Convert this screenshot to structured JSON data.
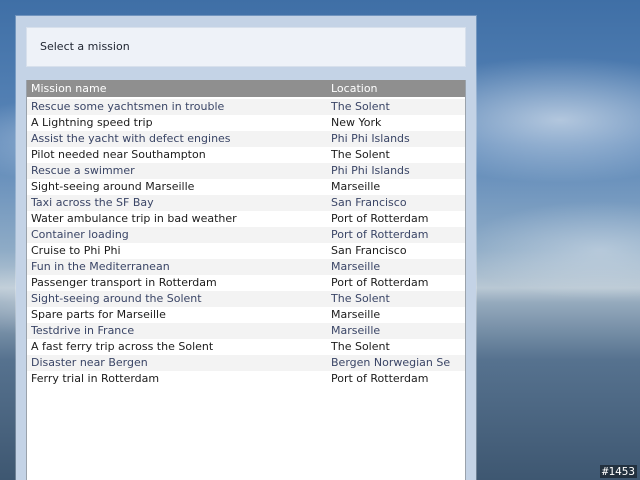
{
  "screen": {
    "title": "Select a mission"
  },
  "mission_list": {
    "columns": {
      "name": "Mission name",
      "location": "Location"
    },
    "rows": [
      {
        "name": "Rescue some yachtsmen in trouble",
        "location": "The Solent"
      },
      {
        "name": "A Lightning speed trip",
        "location": "New York"
      },
      {
        "name": "Assist the yacht with defect engines",
        "location": "Phi Phi Islands"
      },
      {
        "name": "Pilot needed near Southampton",
        "location": "The Solent"
      },
      {
        "name": "Rescue a swimmer",
        "location": "Phi Phi Islands"
      },
      {
        "name": "Sight-seeing around Marseille",
        "location": "Marseille"
      },
      {
        "name": "Taxi across the SF Bay",
        "location": "San Francisco"
      },
      {
        "name": "Water ambulance trip in bad weather",
        "location": "Port of Rotterdam"
      },
      {
        "name": "Container loading",
        "location": "Port of Rotterdam"
      },
      {
        "name": "Cruise to Phi Phi",
        "location": "San Francisco"
      },
      {
        "name": "Fun in the Mediterranean",
        "location": "Marseille"
      },
      {
        "name": "Passenger transport in Rotterdam",
        "location": "Port of Rotterdam"
      },
      {
        "name": "Sight-seeing around the Solent",
        "location": "The Solent"
      },
      {
        "name": "Spare parts for Marseille",
        "location": "Marseille"
      },
      {
        "name": "Testdrive in France",
        "location": "Marseille"
      },
      {
        "name": "A fast ferry trip across the Solent",
        "location": "The Solent"
      },
      {
        "name": "Disaster near Bergen",
        "location": "Bergen Norwegian Se"
      },
      {
        "name": "Ferry trial in Rotterdam",
        "location": "Port of Rotterdam"
      }
    ]
  },
  "overlay": {
    "frame_number": "#1453"
  }
}
